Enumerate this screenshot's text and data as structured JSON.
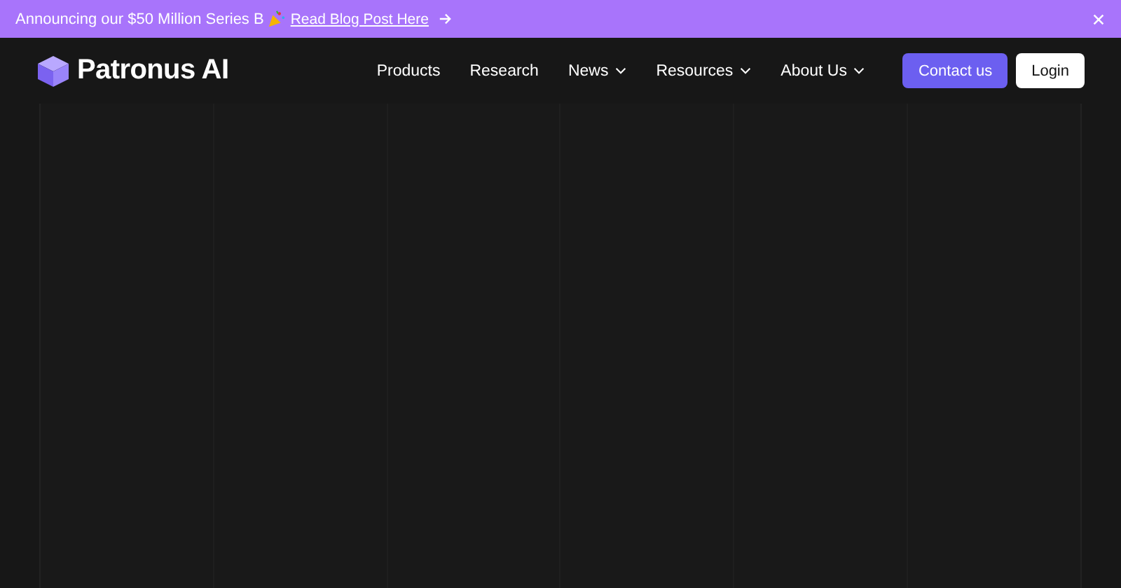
{
  "banner": {
    "text": "Announcing our $50 Million Series B",
    "link": "Read Blog Post Here"
  },
  "header": {
    "brand": "Patronus AI",
    "nav": [
      {
        "label": "Products",
        "dropdown": false
      },
      {
        "label": "Research",
        "dropdown": false
      },
      {
        "label": "News",
        "dropdown": true
      },
      {
        "label": "Resources",
        "dropdown": true
      },
      {
        "label": "About Us",
        "dropdown": true
      }
    ],
    "buttons": [
      {
        "label": "Contact us",
        "kind": "primary"
      },
      {
        "label": "Login",
        "kind": "secondary"
      }
    ]
  }
}
